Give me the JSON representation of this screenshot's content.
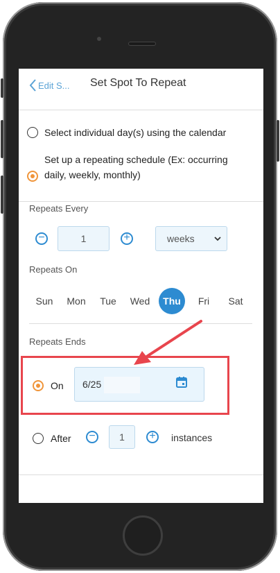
{
  "header": {
    "back_label": "Edit S...",
    "title": "Set Spot To Repeat"
  },
  "options": {
    "calendar_label": "Select individual day(s) using the calendar",
    "repeating_label_line1": "Set up a repeating schedule (Ex: occurring",
    "repeating_label_line2": "daily, weekly, monthly)",
    "selected": "repeating"
  },
  "repeats_every": {
    "label": "Repeats Every",
    "value": "1",
    "unit": "weeks"
  },
  "repeats_on": {
    "label": "Repeats On",
    "days": [
      "Sun",
      "Mon",
      "Tue",
      "Wed",
      "Thu",
      "Fri",
      "Sat"
    ],
    "selected_day": "Thu"
  },
  "repeats_ends": {
    "label": "Repeats Ends",
    "on_label": "On",
    "on_date": "6/25",
    "after_label": "After",
    "after_value": "1",
    "instances_label": "instances",
    "selected": "on"
  },
  "colors": {
    "accent": "#2d8bd1",
    "radio": "#f0953a",
    "annotation": "#e8454d"
  }
}
